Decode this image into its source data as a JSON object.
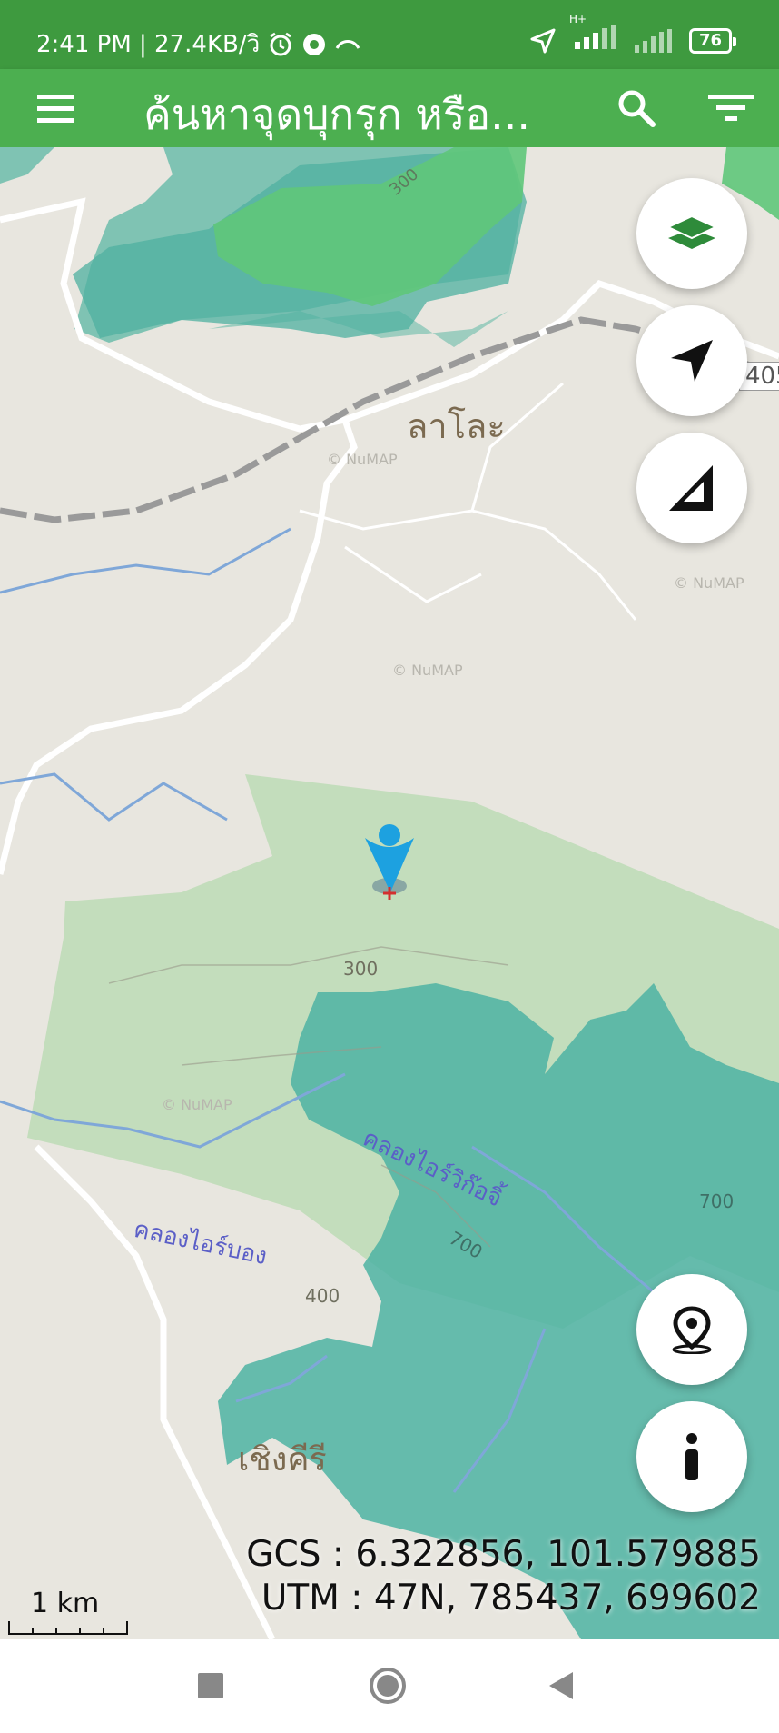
{
  "status_bar": {
    "time_info": "2:41 PM | 27.4KB/วิ",
    "network_type": "H+",
    "battery": "76"
  },
  "app_bar": {
    "title": "ค้นหาจุดบุกรุก หรือ...",
    "menu_icon": "hamburger-menu-icon",
    "search_icon": "search-icon",
    "filter_icon": "filter-icon",
    "background": "#4caf50"
  },
  "map": {
    "place_labels": [
      "ลาโละ",
      "เชิงคีรี"
    ],
    "stream_labels": [
      "คลองไอร์วิก๊อจิ้",
      "คลองไอร์บอง"
    ],
    "contour_labels": [
      "300",
      "300",
      "400",
      "700",
      "700"
    ],
    "road_label": "405",
    "watermark": "© NuMAP",
    "forest_color": "#5fc77a",
    "reserve_color": "#4db3a3",
    "light_forest_color": "#b7d9b0"
  },
  "fab_buttons": {
    "layers": "layers-icon",
    "locate": "navigation-arrow-icon",
    "measure": "ruler-triangle-icon",
    "pin": "location-pin-icon",
    "info": "info-icon"
  },
  "coordinates": {
    "gcs": "GCS : 6.322856, 101.579885",
    "utm": "UTM : 47N, 785437, 699602"
  },
  "scale_bar": {
    "label": "1 km"
  },
  "nav_bar": {
    "recents": "recents-square-icon",
    "home": "home-circle-icon",
    "back": "back-triangle-icon"
  }
}
